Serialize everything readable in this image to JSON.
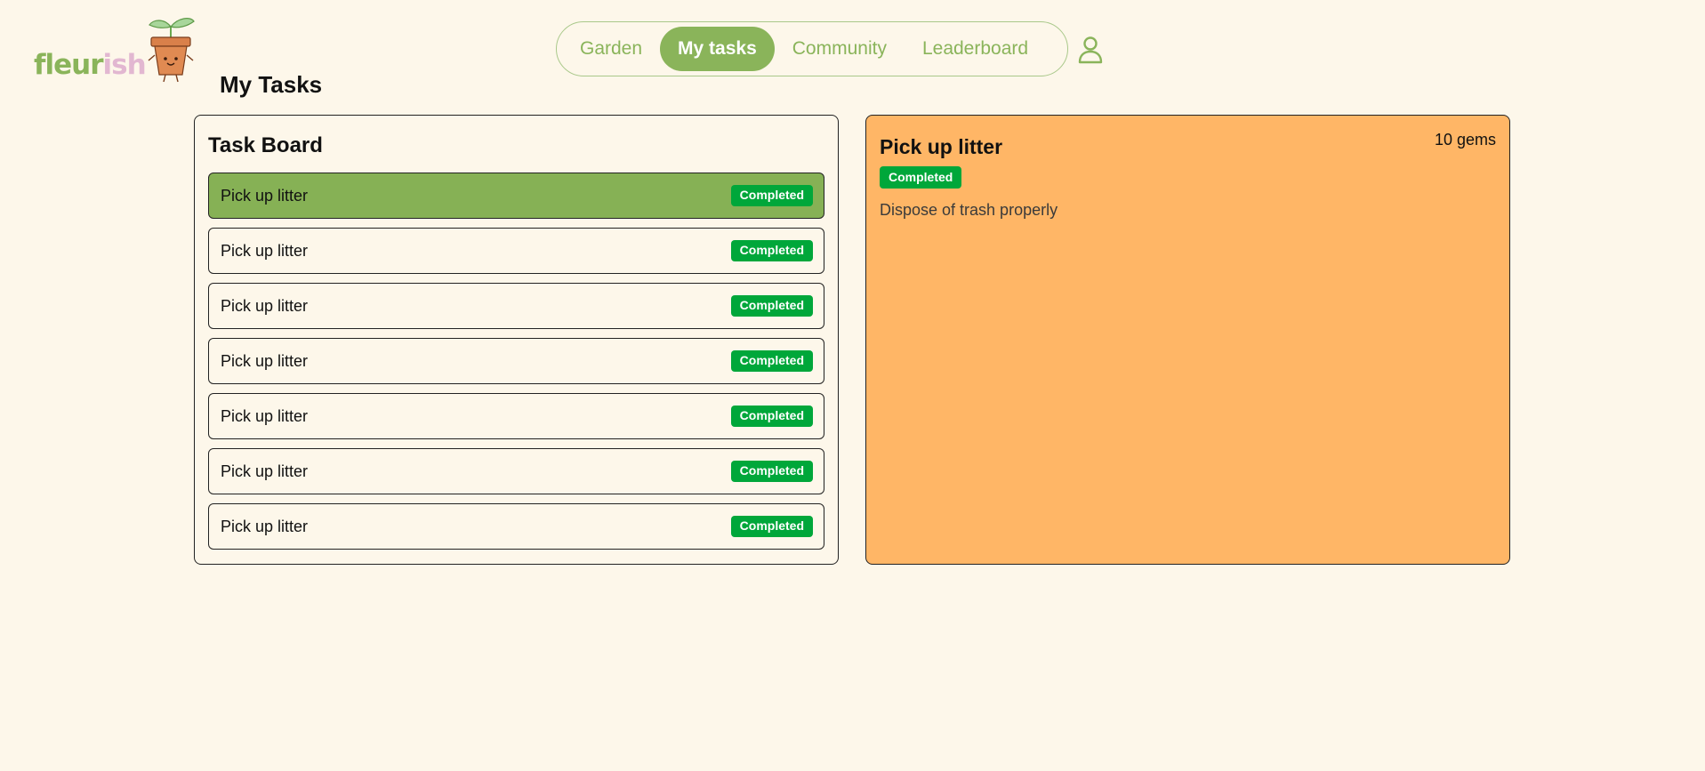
{
  "logo": {
    "text_a": "fleur",
    "text_b": "ish"
  },
  "nav": {
    "items": [
      {
        "label": "Garden",
        "active": false
      },
      {
        "label": "My tasks",
        "active": true
      },
      {
        "label": "Community",
        "active": false
      },
      {
        "label": "Leaderboard",
        "active": false
      }
    ],
    "profile_icon": "person-icon"
  },
  "page": {
    "title": "My Tasks"
  },
  "board": {
    "title": "Task Board",
    "tasks": [
      {
        "name": "Pick up litter",
        "status": "Completed",
        "selected": true
      },
      {
        "name": "Pick up litter",
        "status": "Completed",
        "selected": false
      },
      {
        "name": "Pick up litter",
        "status": "Completed",
        "selected": false
      },
      {
        "name": "Pick up litter",
        "status": "Completed",
        "selected": false
      },
      {
        "name": "Pick up litter",
        "status": "Completed",
        "selected": false
      },
      {
        "name": "Pick up litter",
        "status": "Completed",
        "selected": false
      },
      {
        "name": "Pick up litter",
        "status": "Completed",
        "selected": false
      }
    ]
  },
  "detail": {
    "title": "Pick up litter",
    "gems": "10 gems",
    "status": "Completed",
    "description": "Dispose of trash properly"
  },
  "colors": {
    "background": "#fdf7ea",
    "brand_green": "#8ab45a",
    "brand_pink": "#e2b7d1",
    "selected_row": "#86b155",
    "badge_green": "#00a73a",
    "detail_orange": "#ffb666"
  }
}
